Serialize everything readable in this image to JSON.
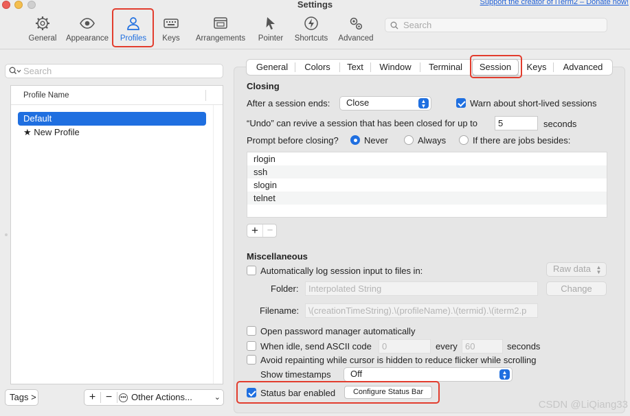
{
  "window": {
    "title": "Settings",
    "support_link": "Support the creator of iTerm2 – Donate now!"
  },
  "toolbar": {
    "items": [
      {
        "label": "General",
        "icon": "gear-icon"
      },
      {
        "label": "Appearance",
        "icon": "eye-icon"
      },
      {
        "label": "Profiles",
        "icon": "person-icon",
        "selected": true
      },
      {
        "label": "Keys",
        "icon": "keyboard-icon"
      },
      {
        "label": "Arrangements",
        "icon": "windows-icon"
      },
      {
        "label": "Pointer",
        "icon": "pointer-icon"
      },
      {
        "label": "Shortcuts",
        "icon": "lightning-icon"
      },
      {
        "label": "Advanced",
        "icon": "gears-icon"
      }
    ],
    "search_placeholder": "Search"
  },
  "left": {
    "search_placeholder": "Search",
    "column_header": "Profile Name",
    "profiles": [
      "Default",
      "New Profile"
    ],
    "default_star": "★",
    "tags_button": "Tags >",
    "add_label": "+",
    "remove_label": "−",
    "other_actions": "Other Actions...",
    "other_actions_chevron": "⌄"
  },
  "tabs": [
    "General",
    "Colors",
    "Text",
    "Window",
    "Terminal",
    "Session",
    "Keys",
    "Advanced"
  ],
  "active_tab": "Session",
  "closing": {
    "title": "Closing",
    "after_ends_label": "After a session ends:",
    "after_ends_value": "Close",
    "warn_label": "Warn about short-lived sessions",
    "warn_checked": true,
    "undo_label": "“Undo” can revive a session that has been closed for up to",
    "undo_value": "5",
    "seconds": "seconds",
    "prompt_label": "Prompt before closing?",
    "prompt_options": [
      "Never",
      "Always",
      "If there are jobs besides:"
    ],
    "prompt_selected": "Never",
    "jobs": [
      "rlogin",
      "ssh",
      "slogin",
      "telnet"
    ],
    "add_label": "+",
    "remove_label": "−"
  },
  "misc": {
    "title": "Miscellaneous",
    "autolog_label": "Automatically log session input to files in:",
    "autolog_format": "Raw data",
    "folder_label": "Folder:",
    "folder_placeholder": "Interpolated String",
    "change_button": "Change",
    "filename_label": "Filename:",
    "filename_value": "\\(creationTimeString).\\(profileName).\\(termid).\\(iterm2.p",
    "password_mgr_label": "Open password manager automatically",
    "idle_label": "When idle, send ASCII code",
    "idle_code": "0",
    "every_label": "every",
    "idle_seconds": "60",
    "seconds": "seconds",
    "avoid_repaint_label": "Avoid repainting while cursor is hidden to reduce flicker while scrolling",
    "timestamps_label": "Show timestamps",
    "timestamps_value": "Off",
    "status_bar_label": "Status bar enabled",
    "status_bar_checked": true,
    "configure_button": "Configure Status Bar"
  },
  "watermark": "CSDN @LiQiang33",
  "colors": {
    "accent": "#1f6fe0",
    "highlight": "#e23c2d"
  }
}
